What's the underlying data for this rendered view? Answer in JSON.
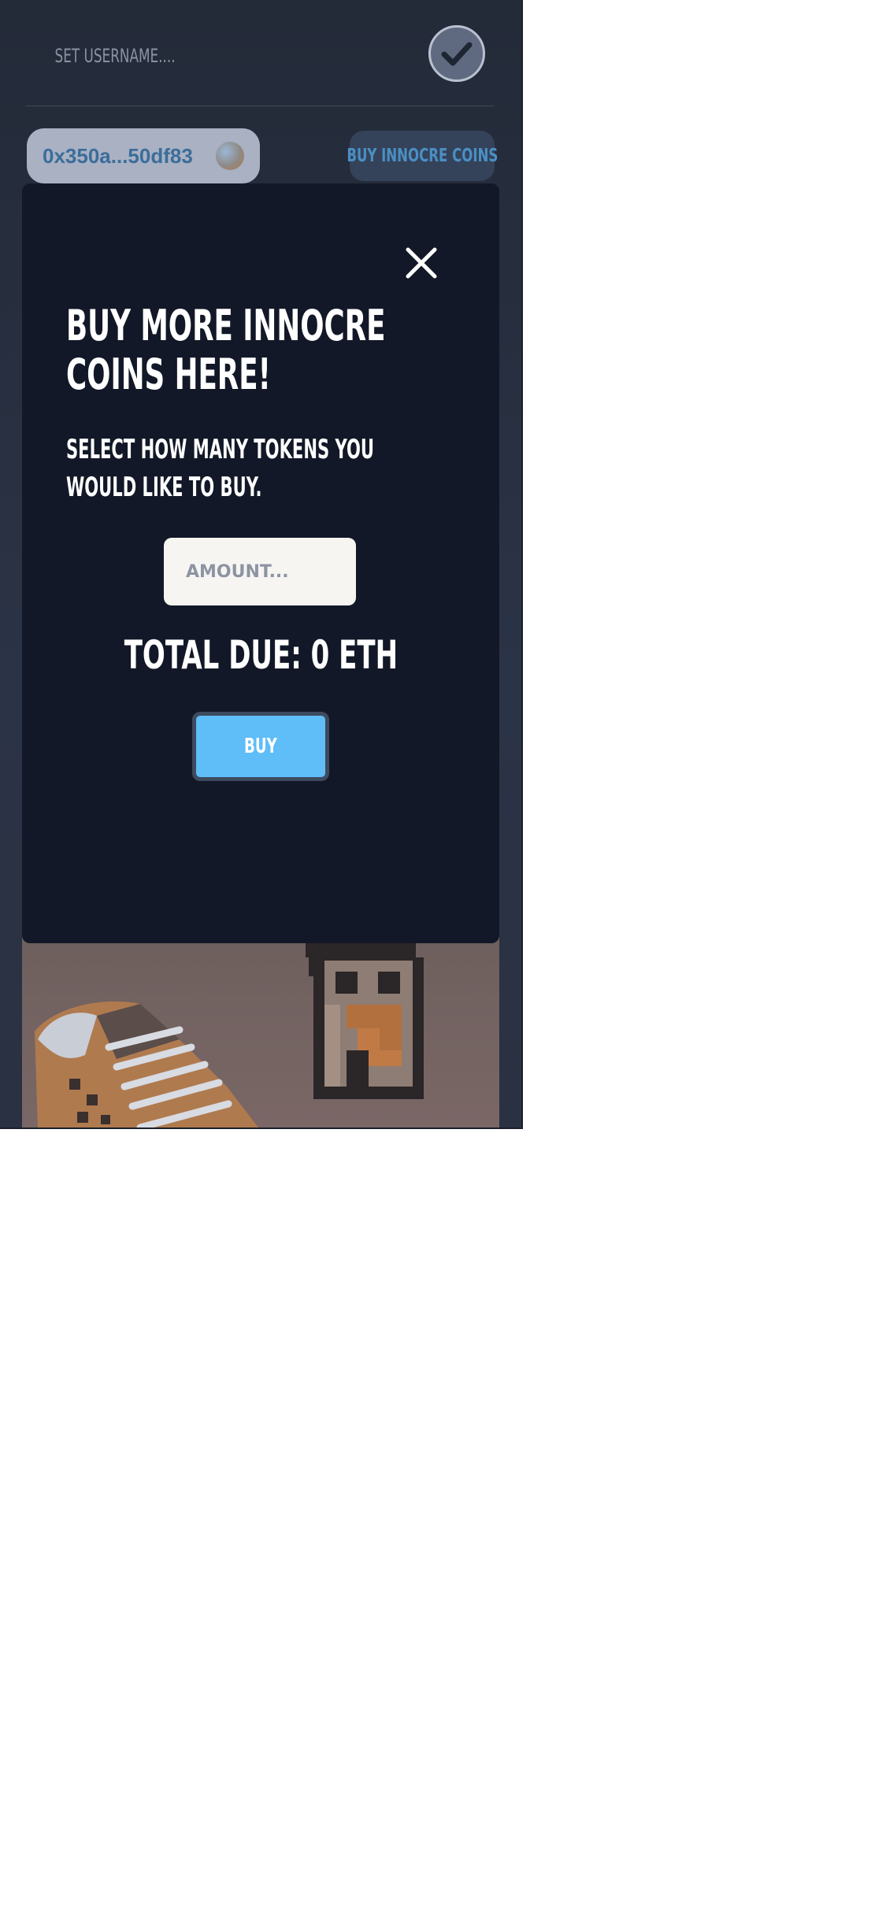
{
  "header": {
    "username_placeholder": "SET USERNAME....",
    "confirm_icon": "checkmark-icon"
  },
  "wallet": {
    "address": "0x350a...50df83",
    "avatar_icon": "wallet-avatar"
  },
  "actions": {
    "buy_coins_label": "BUY INNOCRE COINS"
  },
  "modal": {
    "close_icon": "close-icon",
    "title": "BUY MORE INNOCRE COINS HERE!",
    "subtitle": "SELECT HOW MANY TOKENS YOU WOULD LIKE TO BUY.",
    "amount_placeholder": "AMOUNT...",
    "total_due": "TOTAL DUE: 0 ETH",
    "buy_label": "BUY"
  },
  "colors": {
    "background": "#232a38",
    "modal": "#121827",
    "accent": "#5fbdf8",
    "wallet_pill": "#a9b1c3",
    "wallet_text": "#3b6d9a",
    "buy_coins_text": "#4a8fc4"
  }
}
